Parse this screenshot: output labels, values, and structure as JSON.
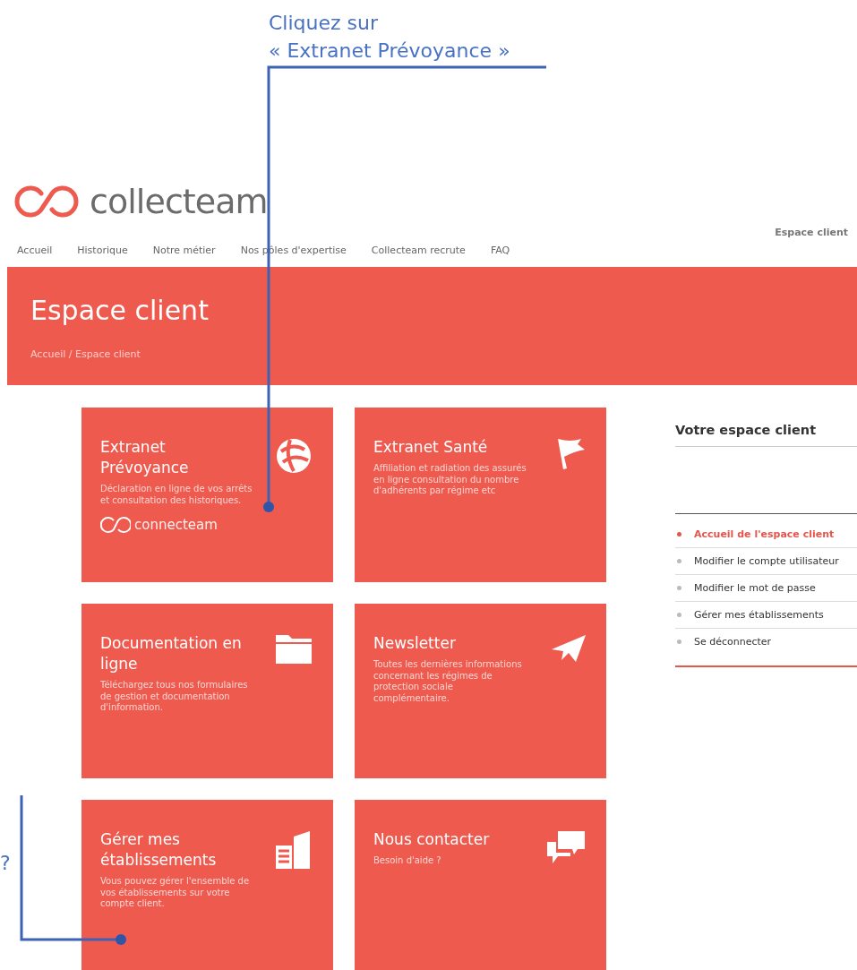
{
  "annotations": [
    {
      "kind": "callout",
      "lines": [
        "Cliquez sur",
        "« Extranet Prévoyance »"
      ]
    },
    {
      "kind": "question",
      "lines": [
        "?"
      ]
    }
  ],
  "logo": {
    "text": "collecteam"
  },
  "nav": {
    "items": [
      {
        "label": "Accueil",
        "selected": false
      },
      {
        "label": "Historique",
        "selected": false
      },
      {
        "label": "Notre métier",
        "selected": false
      },
      {
        "label": "Nos pôles d'expertise",
        "selected": false
      },
      {
        "label": "Collecteam recrute",
        "selected": false
      },
      {
        "label": "FAQ",
        "selected": false
      }
    ],
    "account": "Espace client"
  },
  "banner": {
    "title": "Espace client",
    "breadcrumb": "Accueil / Espace client"
  },
  "cards": [
    {
      "title": "Extranet Prévoyance",
      "description": "Déclaration en ligne de vos arrêts et consultation des historiques.",
      "brand": "connecteam"
    },
    {
      "title": "Extranet Santé",
      "description": "Affiliation et radiation des assurés en ligne consultation du nombre d'adhérents par régime etc"
    },
    {
      "title": "Documentation en ligne",
      "description": "Téléchargez tous nos formulaires de gestion et documentation d'information."
    },
    {
      "title": "Newsletter",
      "description": "Toutes les dernières informations concernant les régimes de protection sociale complémentaire."
    },
    {
      "title": "Gérer mes établissements",
      "description": "Vous pouvez gérer l'ensemble de vos établissements sur votre compte client."
    },
    {
      "title": "Nous contacter",
      "description": "Besoin d'aide ?"
    }
  ],
  "sidebar": {
    "title": "Votre espace client",
    "items": [
      {
        "label": "Accueil de l'espace client",
        "selected": true
      },
      {
        "label": "Modifier le compte utilisateur",
        "selected": false
      },
      {
        "label": "Modifier le mot de passe",
        "selected": false
      },
      {
        "label": "Gérer mes établissements",
        "selected": false
      },
      {
        "label": "Se déconnecter",
        "selected": false
      }
    ]
  }
}
